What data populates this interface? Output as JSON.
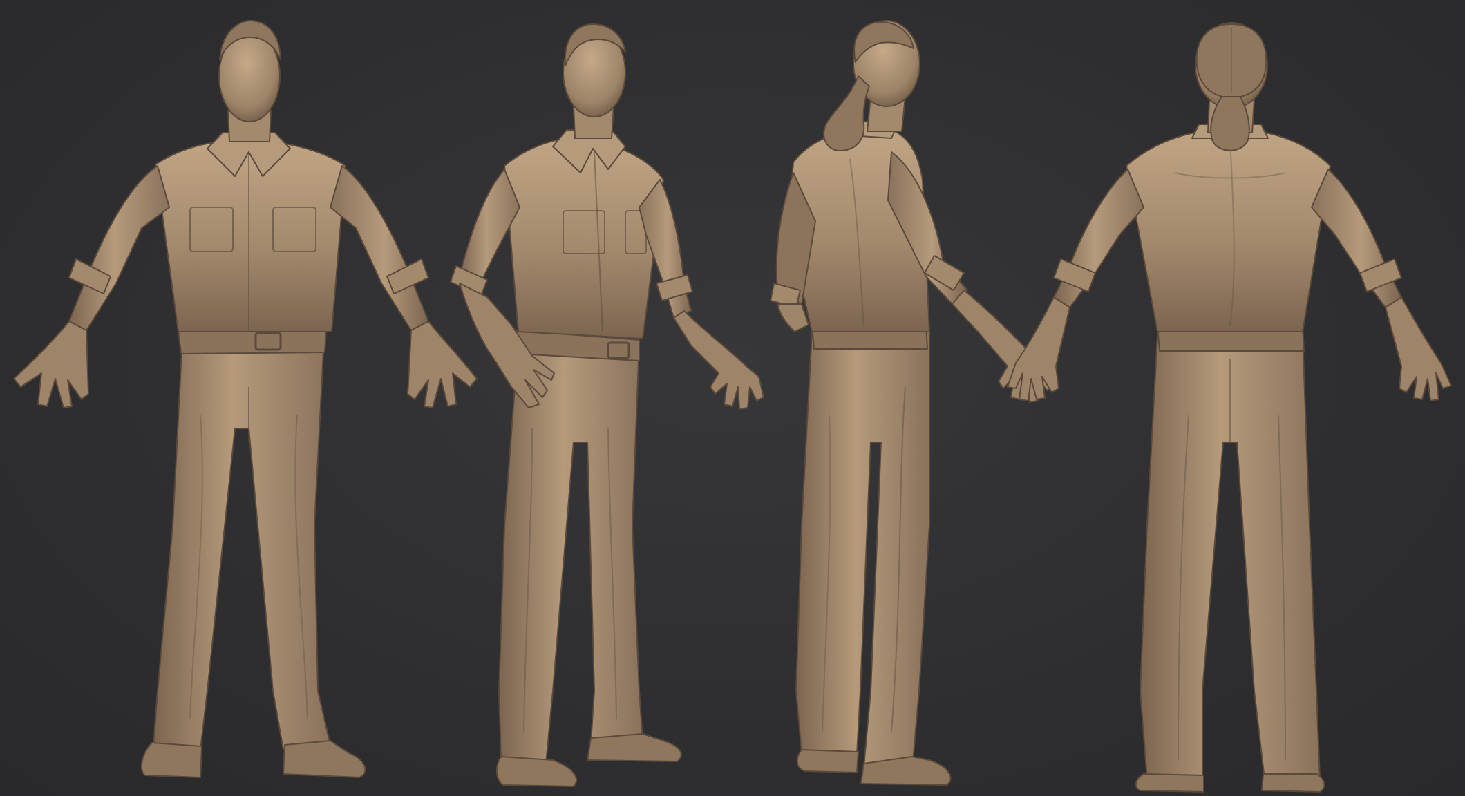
{
  "scene": {
    "background_color": "#2f2f31",
    "clay_base_color": "#a48a6d",
    "clay_highlight_color": "#c0a585",
    "clay_shadow_color": "#6f5a46",
    "outline_color": "#5b4a3b"
  },
  "views": [
    {
      "id": "front",
      "label": ""
    },
    {
      "id": "three-quarter",
      "label": ""
    },
    {
      "id": "side-back",
      "label": ""
    },
    {
      "id": "back",
      "label": ""
    }
  ]
}
